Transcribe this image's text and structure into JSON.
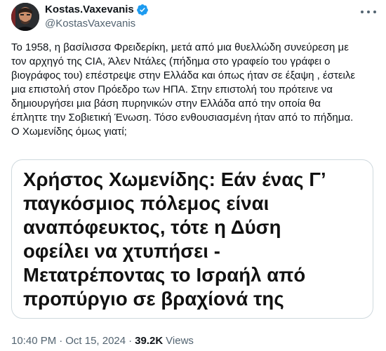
{
  "author": {
    "display_name": "Kostas.Vaxevanis",
    "handle": "@KostasVaxevanis",
    "verified_icon": "verified-badge-icon",
    "verified_color": "#1d9bf0"
  },
  "tweet": {
    "text": "Το 1958, η βασίλισσα Φρειδερίκη, μετά από μια θυελλώδη συνεύρεση με\nτον αρχηγό της CIA, Άλεν Ντάλες (πήδημα στο γραφείο του γράφει ο\nβιογράφος του) επέστρεψε στην Ελλάδα και όπως ήταν σε έξαψη , έστειλε\nμια επιστολή στον Πρόεδρο των ΗΠΑ. Στην επιστολή του πρότεινε να\nδημιουργήσει μια βάση πυρηνικών στην Ελλάδα από την οποία θα\nέπληττε την Σοβιετική Ένωση. Τόσο ενθουσιασμένη ήταν από το πήδημα.\nΟ Χωμενίδης όμως γιατί;"
  },
  "card": {
    "headline": "Χρήστος Χωμενίδης: Εάν ένας Γ’\nπαγκόσμιος πόλεμος είναι\nαναπόφευκτος, τότε η Δύση\nοφείλει να χτυπήσει -\nΜετατρέποντας το Ισραήλ από\nπροπύργιο σε βραχίονά της"
  },
  "meta": {
    "time": "10:40 PM",
    "separator": "·",
    "date": "Oct 15, 2024",
    "separator2": "·",
    "views_count": "39.2K",
    "views_label": "Views"
  },
  "icons": {
    "more": "more-options-icon",
    "avatar": "avatar"
  }
}
